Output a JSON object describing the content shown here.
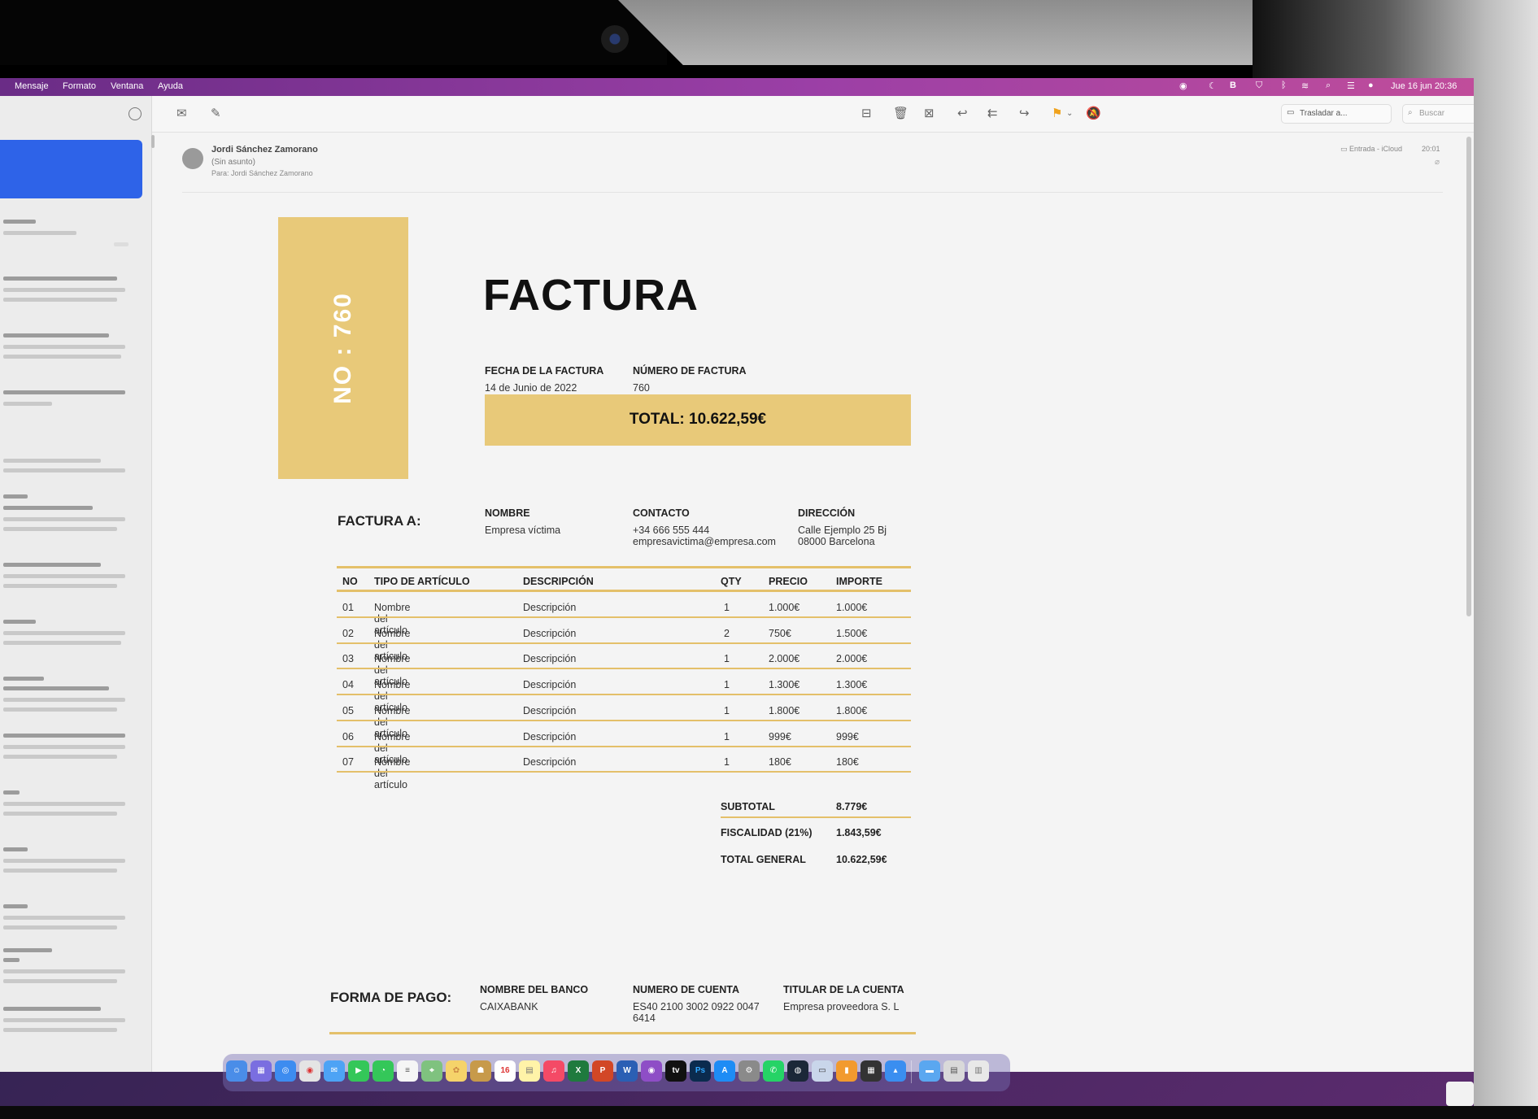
{
  "menubar": {
    "items": [
      "Mensaje",
      "Formato",
      "Ventana",
      "Ayuda"
    ],
    "datetime": "Jue 16 jun  20:36"
  },
  "toolbar": {
    "move_label": "Trasladar a...",
    "search_placeholder": "Buscar"
  },
  "message": {
    "sender": "Jordi Sánchez Zamorano",
    "subject": "(Sin asunto)",
    "to_label": "Para:",
    "to_name": "Jordi Sánchez Zamorano",
    "mailbox": "Entrada - iCloud",
    "time": "20:01"
  },
  "invoice": {
    "side_label": "NO : 760",
    "title": "FACTURA",
    "date_label": "FECHA DE LA FACTURA",
    "date_value": "14 de Junio de 2022",
    "number_label": "NÚMERO DE FACTURA",
    "number_value": "760",
    "total_banner": "TOTAL: 10.622,59€",
    "bill_to": {
      "heading": "FACTURA A:",
      "name_label": "NOMBRE",
      "name_value": "Empresa víctima",
      "contact_label": "CONTACTO",
      "contact_phone": "+34 666 555 444",
      "contact_email": "empresavictima@empresa.com",
      "address_label": "DIRECCIÓN",
      "address_line1": "Calle Ejemplo 25 Bj",
      "address_line2": "08000 Barcelona"
    },
    "table": {
      "headers": [
        "NO",
        "TIPO DE ARTÍCULO",
        "DESCRIPCIÓN",
        "QTY",
        "PRECIO",
        "IMPORTE"
      ],
      "rows": [
        [
          "01",
          "Nombre del artículo",
          "Descripción",
          "1",
          "1.000€",
          "1.000€"
        ],
        [
          "02",
          "Nombre del artículo",
          "Descripción",
          "2",
          "750€",
          "1.500€"
        ],
        [
          "03",
          "Nombre del artículo",
          "Descripción",
          "1",
          "2.000€",
          "2.000€"
        ],
        [
          "04",
          "Nombre del artículo",
          "Descripción",
          "1",
          "1.300€",
          "1.300€"
        ],
        [
          "05",
          "Nombre del artículo",
          "Descripción",
          "1",
          "1.800€",
          "1.800€"
        ],
        [
          "06",
          "Nombre del artículo",
          "Descripción",
          "1",
          "999€",
          "999€"
        ],
        [
          "07",
          "Nombre del artículo",
          "Descripción",
          "1",
          "180€",
          "180€"
        ]
      ]
    },
    "totals": {
      "subtotal_label": "SUBTOTAL",
      "subtotal_value": "8.779€",
      "tax_label": "FISCALIDAD (21%)",
      "tax_value": "1.843,59€",
      "grand_label": "TOTAL GENERAL",
      "grand_value": "10.622,59€"
    },
    "payment": {
      "heading": "FORMA DE PAGO:",
      "bank_label": "NOMBRE DEL BANCO",
      "bank_value": "CAIXABANK",
      "account_label": "NUMERO DE CUENTA",
      "account_line1": "ES40 2100 3002 0922 0047",
      "account_line2": "6414",
      "holder_label": "TITULAR DE LA CUENTA",
      "holder_value": "Empresa proveedora S. L"
    }
  },
  "dock": {
    "labels": {
      "calendar_day": "16",
      "tv": "tv",
      "photoshop": "Ps"
    }
  },
  "colors": {
    "accent_gold": "#e8c979",
    "selection_blue": "#2e63e8",
    "flag_orange": "#f0a21c"
  }
}
